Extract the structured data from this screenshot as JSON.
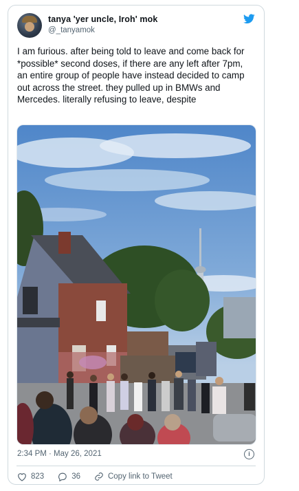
{
  "author": {
    "display_name": "tanya 'yer uncle, Iroh' mok",
    "handle": "@_tanyamok"
  },
  "brand": {
    "icon": "twitter-bird-icon",
    "color": "#1d9bf0"
  },
  "tweet": {
    "text": "I am furious. after being told to leave and come back for *possible* second doses, if there are any left after 7pm, an entire group of people have instead decided to camp out across the street. they pulled up in BMWs and Mercedes. literally refusing to leave, despite",
    "timestamp": "2:34 PM · May 26, 2021"
  },
  "actions": {
    "likes": "823",
    "replies": "36",
    "copy_link_label": "Copy link to Tweet"
  },
  "icons": {
    "info": "info-icon",
    "heart": "heart-icon",
    "reply": "reply-icon",
    "link": "link-icon"
  }
}
